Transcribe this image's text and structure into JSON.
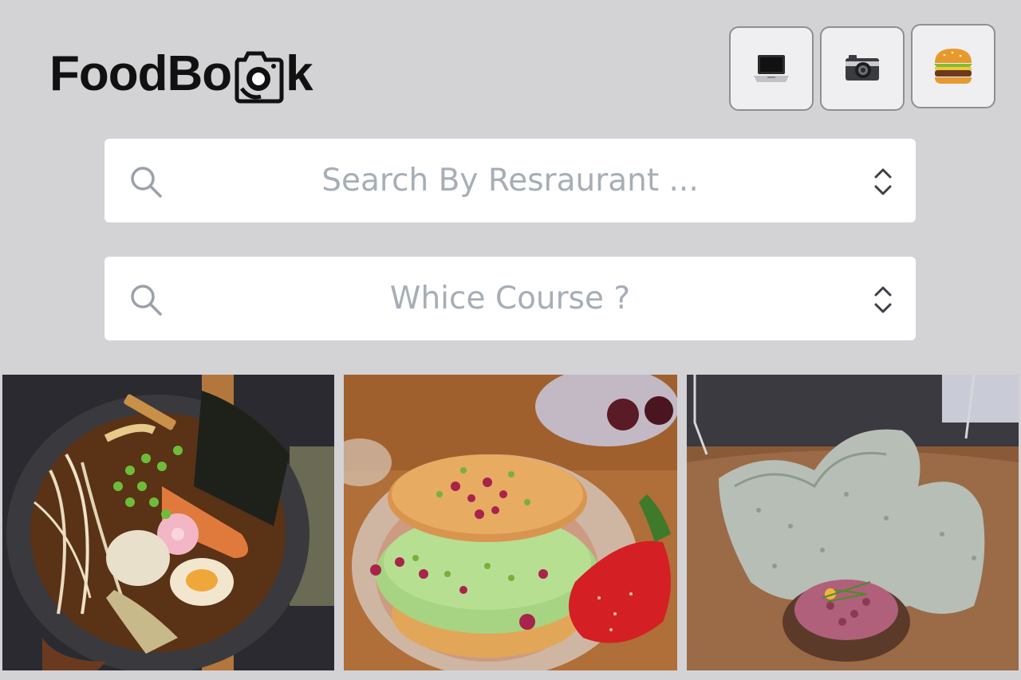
{
  "app": {
    "logo_prefix": "FoodBo",
    "logo_suffix": "k"
  },
  "header_buttons": [
    {
      "icon": "laptop-icon",
      "glyph": "💻"
    },
    {
      "icon": "camera-icon",
      "glyph": "📷"
    },
    {
      "icon": "burger-icon",
      "glyph": "🍔"
    }
  ],
  "search": {
    "restaurant_placeholder": "Search By Resraurant ...",
    "course_placeholder": "Whice Course ?"
  },
  "photos": [
    {
      "subject": "ramen"
    },
    {
      "subject": "matcha-donut-with-strawberry"
    },
    {
      "subject": "crisps-with-tartare"
    }
  ]
}
